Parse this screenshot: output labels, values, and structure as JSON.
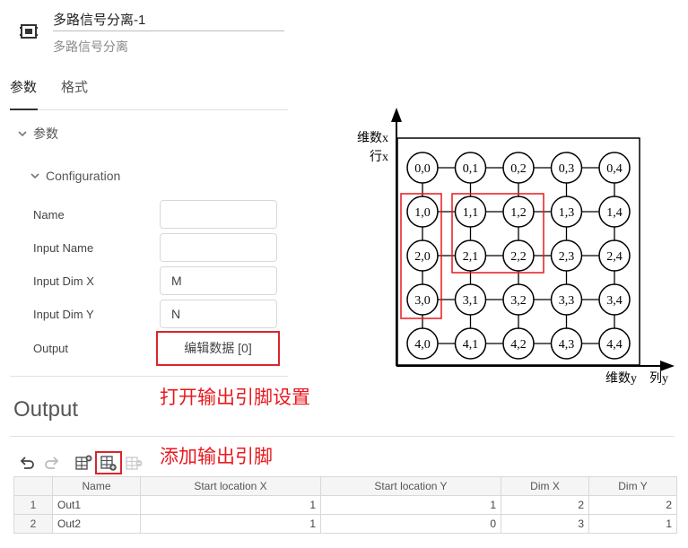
{
  "header": {
    "block_name": "多路信号分离-1",
    "block_type": "多路信号分离",
    "icon": "demux-block-icon"
  },
  "tabs": [
    {
      "label": "参数",
      "active": true
    },
    {
      "label": "格式",
      "active": false
    }
  ],
  "params_section": {
    "label": "参数"
  },
  "config_section": {
    "label": "Configuration"
  },
  "properties": {
    "name": {
      "label": "Name",
      "value": ""
    },
    "input_name": {
      "label": "Input Name",
      "value": ""
    },
    "input_dim_x": {
      "label": "Input Dim X",
      "value": "M"
    },
    "input_dim_y": {
      "label": "Input Dim Y",
      "value": "N"
    },
    "output": {
      "label": "Output",
      "button_label": "编辑数据 [0]"
    }
  },
  "annotations": {
    "open_output_pins": "打开输出引脚设置",
    "add_output_pin": "添加输出引脚"
  },
  "output": {
    "title": "Output",
    "toolbar": [
      "undo-icon",
      "redo-icon",
      "insert-row-icon",
      "add-row-icon",
      "delete-row-icon"
    ],
    "columns": [
      "Name",
      "Start location X",
      "Start location Y",
      "Dim X",
      "Dim Y"
    ],
    "rows": [
      {
        "index": "1",
        "name": "Out1",
        "start_x": "1",
        "start_y": "1",
        "dim_x": "2",
        "dim_y": "2"
      },
      {
        "index": "2",
        "name": "Out2",
        "start_x": "1",
        "start_y": "0",
        "dim_x": "3",
        "dim_y": "1"
      }
    ]
  },
  "diagram": {
    "axis_dim_x": "维数x",
    "axis_row_x": "行x",
    "axis_dim_y": "维数y",
    "axis_col_y": "列y",
    "cells": [
      [
        "0,0",
        "0,1",
        "0,2",
        "0,3",
        "0,4"
      ],
      [
        "1,0",
        "1,1",
        "1,2",
        "1,3",
        "1,4"
      ],
      [
        "2,0",
        "2,1",
        "2,2",
        "2,3",
        "2,4"
      ],
      [
        "3,0",
        "3,1",
        "3,2",
        "3,3",
        "3,4"
      ],
      [
        "4,0",
        "4,1",
        "4,2",
        "4,3",
        "4,4"
      ]
    ],
    "highlight_color": "#e8191f"
  }
}
